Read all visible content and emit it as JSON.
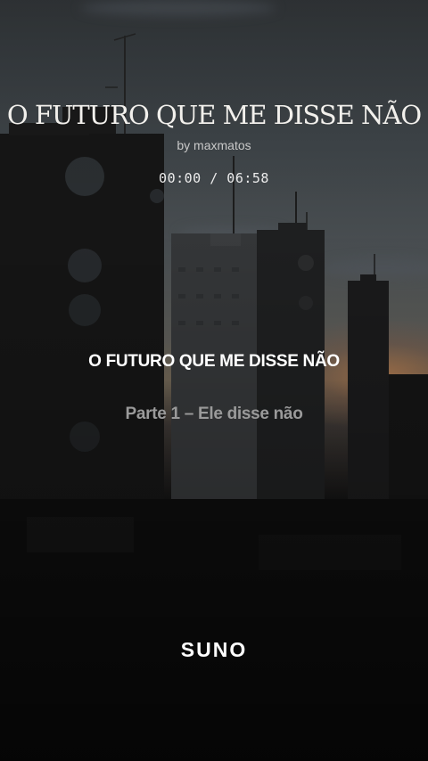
{
  "song": {
    "title_top": "O FUTURO QUE ME DISSE NÃO",
    "byline": "by maxmatos",
    "time_elapsed": "00:00",
    "time_separator": " / ",
    "time_total": "06:58"
  },
  "lyrics": {
    "current_line": "O FUTURO QUE ME DISSE NÃO",
    "next_line": "Parte 1 – Ele disse não"
  },
  "brand": {
    "logo_text": "SUNO"
  },
  "colors": {
    "sunset_glow": "#d2824a",
    "text_primary": "#ffffff",
    "text_muted": "#9a9a9a"
  }
}
